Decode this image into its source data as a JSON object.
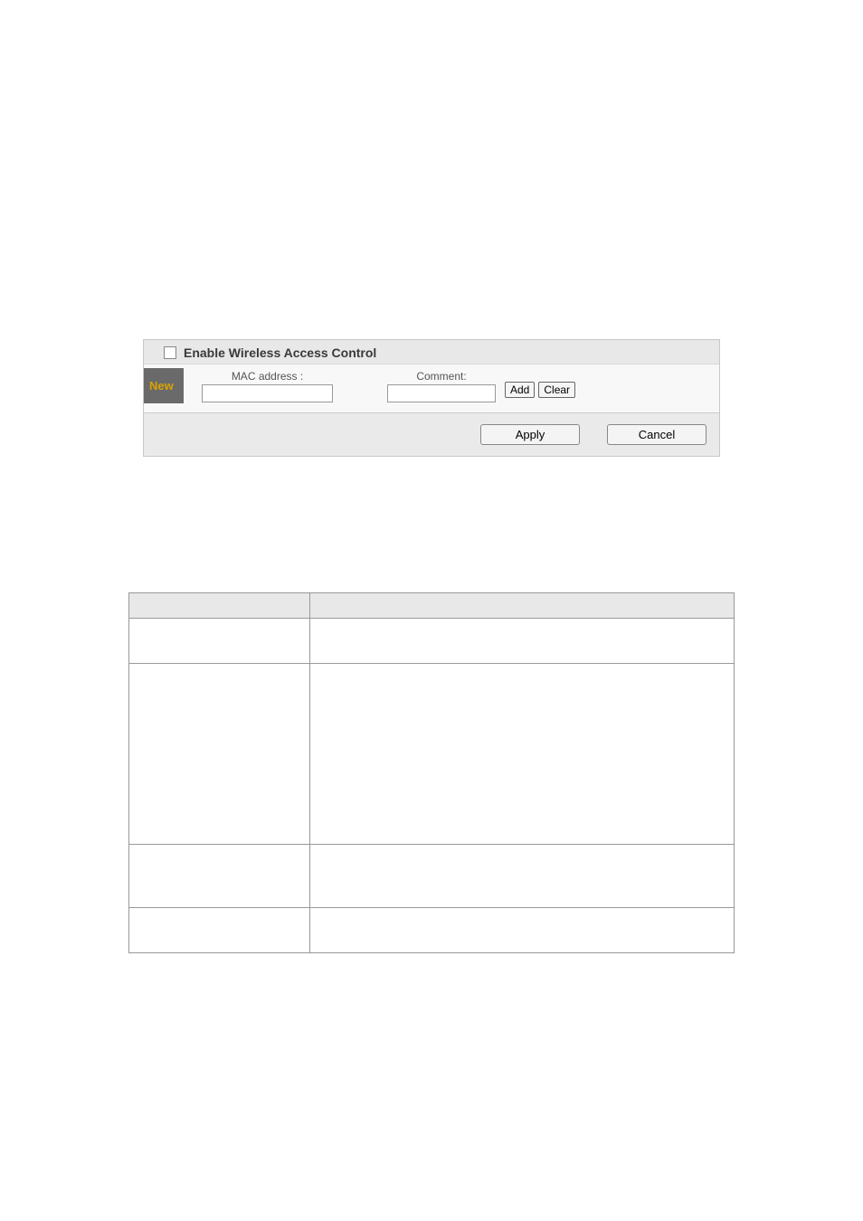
{
  "panel": {
    "title": "Enable Wireless Access Control",
    "row_label": "New",
    "mac_label": "MAC address :",
    "comment_label": "Comment:",
    "add_btn": "Add",
    "clear_btn": "Clear",
    "apply_btn": "Apply",
    "cancel_btn": "Cancel"
  },
  "table": {
    "headers": [
      "",
      ""
    ],
    "rows": [
      [
        "",
        ""
      ],
      [
        "",
        ""
      ],
      [
        "",
        ""
      ],
      [
        "",
        ""
      ]
    ]
  }
}
